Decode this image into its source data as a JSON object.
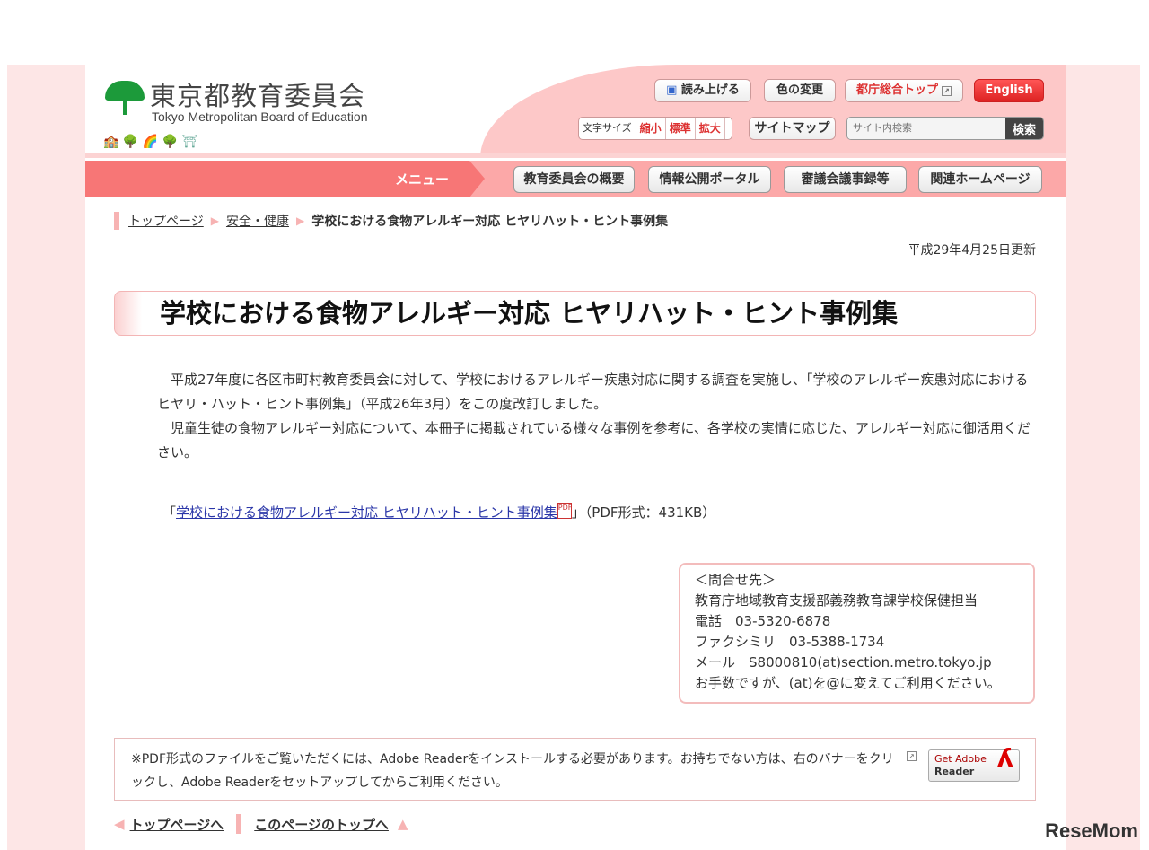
{
  "header": {
    "logo_jp": "東京都教育委員会",
    "logo_en": "Tokyo Metropolitan Board of Education",
    "read_aloud": "読み上げる",
    "color_change": "色の変更",
    "metro_top": "都庁総合トップ",
    "english": "English",
    "font_size_label": "文字サイズ",
    "font_small": "縮小",
    "font_standard": "標準",
    "font_large": "拡大",
    "sitemap": "サイトマップ",
    "search_placeholder": "サイト内検索",
    "search_button": "検索"
  },
  "nav": {
    "menu_label": "メニュー",
    "items": [
      "教育委員会の概要",
      "情報公開ポータル",
      "審議会議事録等",
      "関連ホームページ"
    ]
  },
  "breadcrumb": [
    "トップページ",
    "安全・健康",
    "学校における食物アレルギー対応 ヒヤリハット・ヒント事例集"
  ],
  "updated": "平成29年4月25日更新",
  "title": "学校における食物アレルギー対応 ヒヤリハット・ヒント事例集",
  "body": [
    "平成27年度に各区市町村教育委員会に対して、学校におけるアレルギー疾患対応に関する調査を実施し、「学校のアレルギー疾患対応におけるヒヤリ・ハット・ヒント事例集」（平成26年3月）をこの度改訂しました。",
    "児童生徒の食物アレルギー対応について、本冊子に掲載されている様々な事例を参考に、各学校の実情に応じた、アレルギー対応に御活用ください。"
  ],
  "pdf": {
    "open": "「",
    "link": "学校における食物アレルギー対応 ヒヤリハット・ヒント事例集",
    "close": "」（PDF形式：431KB）"
  },
  "contact": [
    "＜問合せ先＞",
    "教育庁地域教育支援部義務教育課学校保健担当",
    "電話　03-5320-6878",
    "ファクシミリ　03-5388-1734",
    "メール　S8000810(at)section.metro.tokyo.jp",
    "お手数ですが、(at)を@に変えてご利用ください。"
  ],
  "note": "※PDF形式のファイルをご覧いただくには、Adobe Readerをインストールする必要があります。お持ちでない方は、右のバナーをクリックし、Adobe Readerをセットアップしてからご利用ください。",
  "adobe": {
    "line1": "Get Adobe",
    "line2": "Reader"
  },
  "footer": {
    "to_top_page": "トップページへ",
    "page_top": "このページのトップへ"
  },
  "brand": "ReseMom"
}
